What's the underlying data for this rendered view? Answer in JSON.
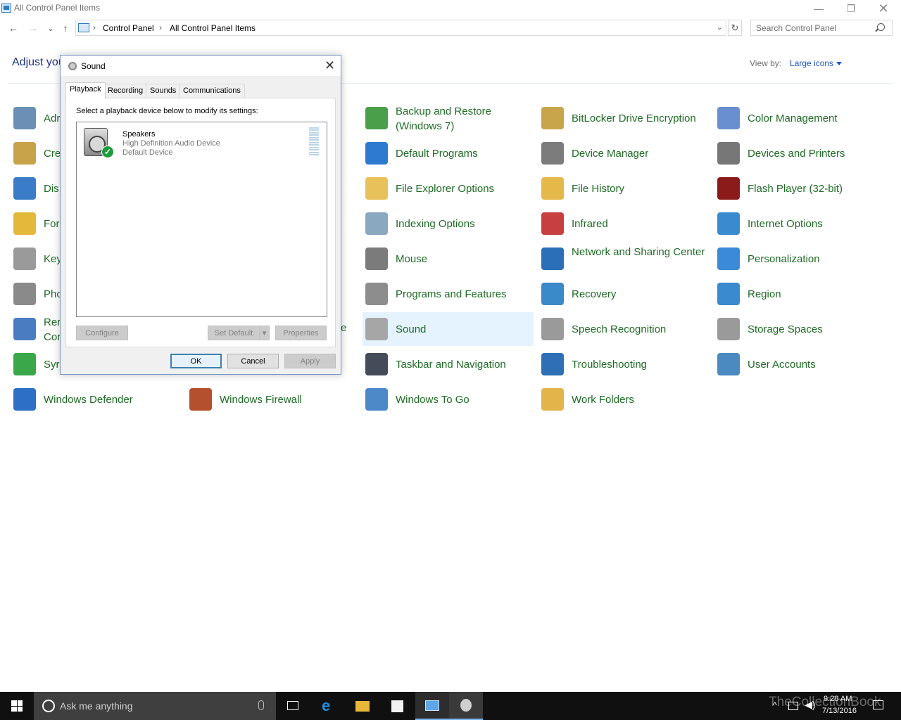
{
  "window": {
    "title": "All Control Panel Items",
    "minimize_icon": "minimize-icon",
    "restore_icon": "restore-icon",
    "close_icon": "close-icon"
  },
  "nav": {
    "back": "←",
    "forward": "→",
    "recent": "⌄",
    "up": "↑",
    "breadcrumb": [
      "Control Panel",
      "All Control Panel Items"
    ],
    "separator": "›",
    "dropdown": "⌄",
    "refresh": "↻",
    "search_placeholder": "Search Control Panel"
  },
  "header": {
    "adjust_text": "Adjust you",
    "view_by_label": "View by:",
    "view_by_value": "Large icons"
  },
  "items": [
    {
      "label": "Adr",
      "color": "#6b8fb5"
    },
    {
      "label": "Cre",
      "color": "#c9a34a"
    },
    {
      "label": "Dis",
      "color": "#3a7cc7"
    },
    {
      "label": "For",
      "color": "#e2b93b"
    },
    {
      "label": "Key",
      "color": "#9a9a9a"
    },
    {
      "label": "Pho",
      "color": "#8a8a8a"
    },
    {
      "label": "Rer Cor",
      "color": "#4a7cc2"
    },
    {
      "label": "Syr",
      "color": "#3aa84a"
    },
    {
      "label": "Windows Defender",
      "color": "#2b6fc7"
    },
    {
      "label": "Windows Firewall",
      "color": "#b5502e"
    },
    {
      "label": "Backup and Restore (Windows 7)",
      "color": "#4aa04a"
    },
    {
      "label": "Default Programs",
      "color": "#2f7ad1"
    },
    {
      "label": "File Explorer Options",
      "color": "#e8c15a"
    },
    {
      "label": "Indexing Options",
      "color": "#8aa8c0"
    },
    {
      "label": "Mouse",
      "color": "#7b7b7b"
    },
    {
      "label": "Programs and Features",
      "color": "#8d8d8d"
    },
    {
      "label": "Sound",
      "color": "#a6a6a6"
    },
    {
      "label": "Taskbar and Navigation",
      "color": "#444c5a"
    },
    {
      "label": "Windows To Go",
      "color": "#4d88c9"
    },
    {
      "label": "BitLocker Drive Encryption",
      "color": "#c8a54a"
    },
    {
      "label": "Device Manager",
      "color": "#7c7c7c"
    },
    {
      "label": "File History",
      "color": "#e5b84a"
    },
    {
      "label": "Infrared",
      "color": "#c74040"
    },
    {
      "label": "Network and Sharing Center",
      "color": "#2b6fb8"
    },
    {
      "label": "Recovery",
      "color": "#3a89c9"
    },
    {
      "label": "Speech Recognition",
      "color": "#9a9a9a"
    },
    {
      "label": "Troubleshooting",
      "color": "#2f6fb5"
    },
    {
      "label": "Work Folders",
      "color": "#e3b44a"
    },
    {
      "label": "Color Management",
      "color": "#6a8fd0"
    },
    {
      "label": "Devices and Printers",
      "color": "#777777"
    },
    {
      "label": "Flash Player (32-bit)",
      "color": "#8b1a1a"
    },
    {
      "label": "Internet Options",
      "color": "#3a8ad0"
    },
    {
      "label": "Personalization",
      "color": "#3a8ad9"
    },
    {
      "label": "Region",
      "color": "#3a8ad0"
    },
    {
      "label": "Storage Spaces",
      "color": "#9a9a9a"
    },
    {
      "label": "User Accounts",
      "color": "#4a8ac0"
    }
  ],
  "item_partial_suffix": "e",
  "dialog": {
    "title": "Sound",
    "tabs": [
      "Playback",
      "Recording",
      "Sounds",
      "Communications"
    ],
    "instruction": "Select a playback device below to modify its settings:",
    "device": {
      "name": "Speakers",
      "description": "High Definition Audio Device",
      "status": "Default Device",
      "check": "✓"
    },
    "buttons": {
      "configure": "Configure",
      "set_default": "Set Default",
      "set_default_arrow": "▾",
      "properties": "Properties",
      "ok": "OK",
      "cancel": "Cancel",
      "apply": "Apply"
    }
  },
  "taskbar": {
    "search_placeholder": "Ask me anything",
    "time": "9:28 AM",
    "date": "7/13/2016",
    "watermark": "TheCollectionBook"
  }
}
